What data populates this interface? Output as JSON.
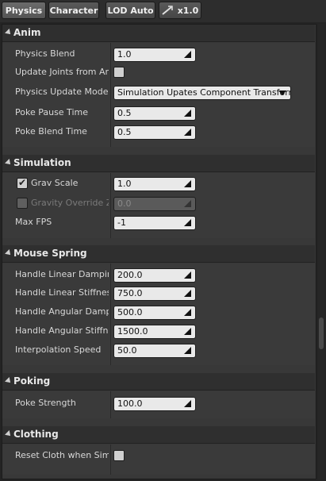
{
  "toolbar": {
    "physics_label": "Physics",
    "character_label": "Character",
    "lod_label": "LOD Auto",
    "speed_label": "x1.0"
  },
  "categories": {
    "anim": "Anim",
    "simulation": "Simulation",
    "mouse_spring": "Mouse Spring",
    "poking": "Poking",
    "clothing": "Clothing"
  },
  "anim": {
    "physics_blend": {
      "label": "Physics Blend",
      "value": "1.0"
    },
    "update_joints": {
      "label": "Update Joints from Animation",
      "checked": false
    },
    "physics_update_mode": {
      "label": "Physics Update Mode",
      "value": "Simulation Upates Component Transform"
    },
    "poke_pause_time": {
      "label": "Poke Pause Time",
      "value": "0.5"
    },
    "poke_blend_time": {
      "label": "Poke Blend Time",
      "value": "0.5"
    }
  },
  "simulation": {
    "grav_scale": {
      "label": "Grav Scale",
      "value": "1.0",
      "checked": true
    },
    "gravity_override_z": {
      "label": "Gravity Override Z",
      "value": "0.0",
      "checked": false
    },
    "max_fps": {
      "label": "Max FPS",
      "value": "-1"
    }
  },
  "mouse_spring": {
    "handle_linear_damping": {
      "label": "Handle Linear Damping",
      "value": "200.0"
    },
    "handle_linear_stiffness": {
      "label": "Handle Linear Stiffness",
      "value": "750.0"
    },
    "handle_angular_damping": {
      "label": "Handle Angular Damping",
      "value": "500.0"
    },
    "handle_angular_stiffness": {
      "label": "Handle Angular Stiffness",
      "value": "1500.0"
    },
    "interpolation_speed": {
      "label": "Interpolation Speed",
      "value": "50.0"
    }
  },
  "poking": {
    "poke_strength": {
      "label": "Poke Strength",
      "value": "100.0"
    }
  },
  "clothing": {
    "reset_cloth": {
      "label": "Reset Cloth when Simulating",
      "checked": false
    }
  }
}
